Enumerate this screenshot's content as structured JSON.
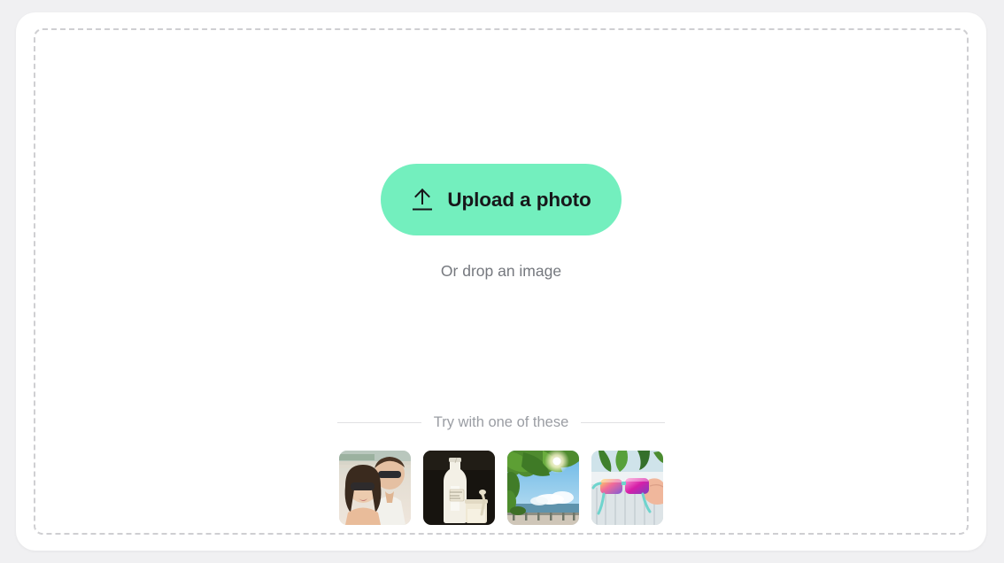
{
  "page": {
    "background_color": "#f0f0f2",
    "card_background": "#ffffff"
  },
  "dropzone": {
    "border_style": "dashed",
    "border_color": "#cfcfd2",
    "upload_button": {
      "label": "Upload a photo",
      "icon": "upload-arrow-icon",
      "background_color": "#73efbe",
      "text_color": "#17171a"
    },
    "drop_hint": "Or drop an image"
  },
  "samples": {
    "title": "Try with one of these",
    "title_color": "#9a9da3",
    "divider_color": "#e0e0e3",
    "thumbnails": [
      {
        "name": "couple-selfie-sunglasses",
        "alt": "Couple wearing sunglasses taking a selfie"
      },
      {
        "name": "milk-bottle-still-life",
        "alt": "Glass milk bottle and jar on dark background"
      },
      {
        "name": "tropical-beach-palm",
        "alt": "Tropical beach framed by green palm leaves"
      },
      {
        "name": "sunglasses-on-ledge",
        "alt": "Colorful mirrored sunglasses on a white ledge"
      }
    ]
  }
}
